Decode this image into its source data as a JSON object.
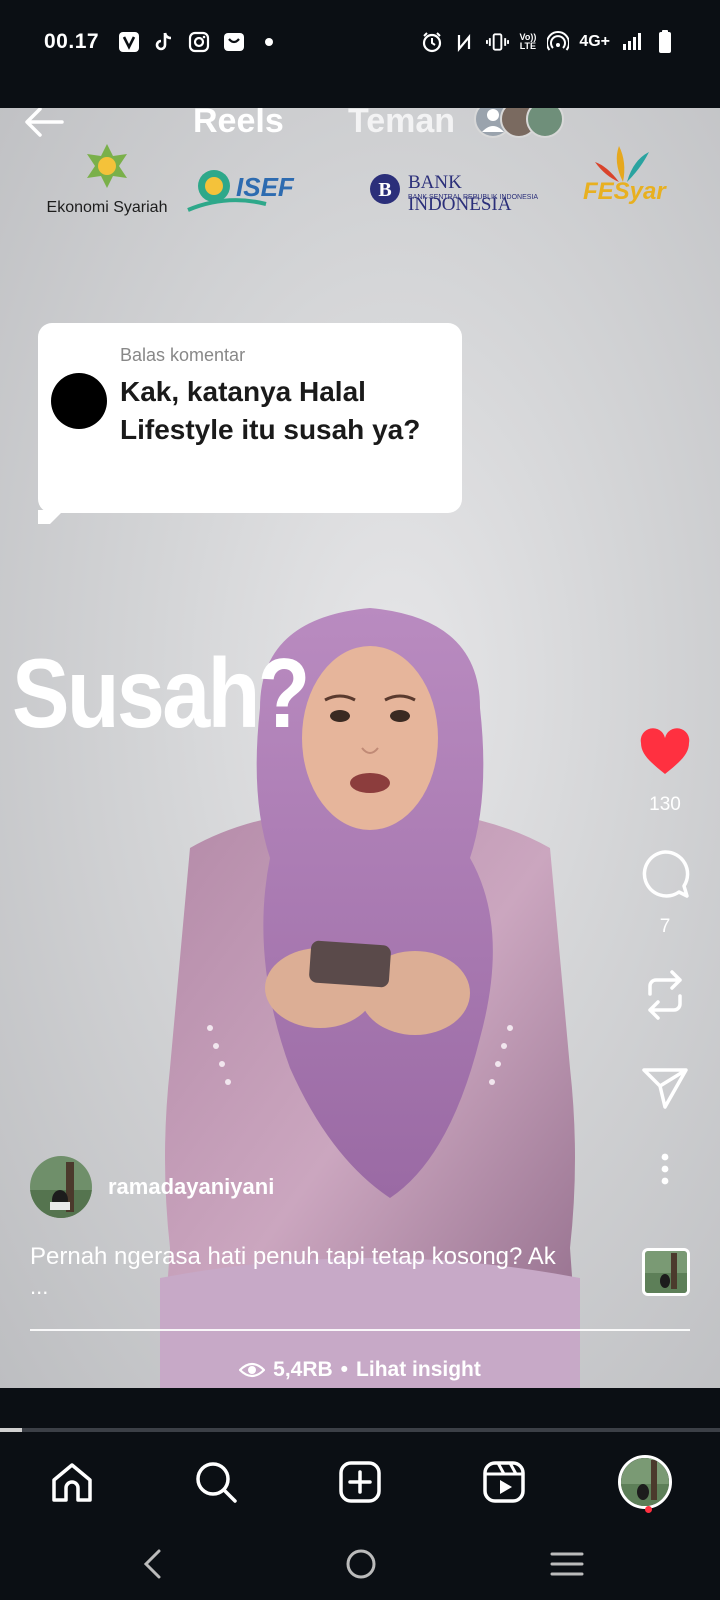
{
  "status_bar": {
    "time": "00.17",
    "left_icons": [
      "v-app-icon",
      "tiktok-icon",
      "instagram-icon",
      "shopping-bag-icon",
      "dot-icon"
    ],
    "right_icons": [
      "alarm-icon",
      "nfc-icon",
      "vibrate-icon",
      "volte-icon",
      "hotspot-icon",
      "signal-icon",
      "battery-icon"
    ],
    "volte_top": "Vo))",
    "volte_bottom": "LTE",
    "network": "4G+"
  },
  "top_nav": {
    "tab_reels": "Reels",
    "tab_friends": "Teman"
  },
  "sponsors": {
    "ekonomi_syariah": "Ekonomi Syariah",
    "bank_indonesia": "BANK INDONESIA",
    "bank_indonesia_sub": "BANK SENTRAL REPUBLIK INDONESIA",
    "isef": "ISEF",
    "fesyar": "FESyar"
  },
  "comment_bubble": {
    "label": "Balas komentar",
    "text": "Kak, katanya Halal Lifestyle itu susah ya?"
  },
  "overlay_text": "Susah?",
  "actions": {
    "likes": "130",
    "comments": "7",
    "like_color": "#ff3040"
  },
  "author": {
    "username": "ramadayaniyani"
  },
  "caption": {
    "text": "Pernah ngerasa hati penuh tapi tetap kosong? Ak",
    "more": "..."
  },
  "insight": {
    "views": "5,4RB",
    "separator": "•",
    "link": "Lihat insight"
  },
  "video_progress": 0.03,
  "bottom_tabs": [
    "home-icon",
    "search-icon",
    "create-icon",
    "reels-icon",
    "profile-avatar"
  ],
  "system_nav": [
    "back",
    "home",
    "recents"
  ]
}
